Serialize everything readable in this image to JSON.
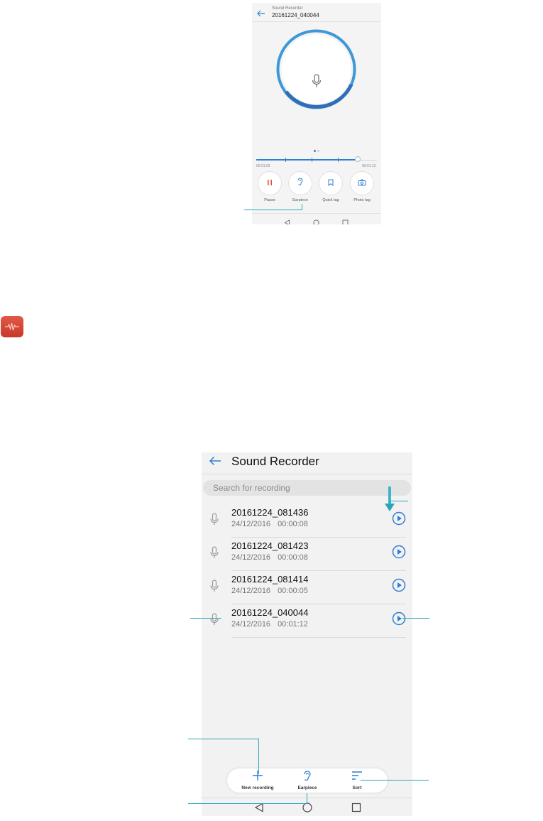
{
  "recording_screen": {
    "app_title": "Sound Recorder",
    "file_name": "20161224_040044",
    "elapsed_time": "00:01:03",
    "total_time": "00:01:12",
    "progress_fraction": 0.84,
    "page_dots": 2,
    "active_page": 0,
    "controls": [
      {
        "label": "Pause",
        "icon": "pause-icon"
      },
      {
        "label": "Earpiece",
        "icon": "ear-icon"
      },
      {
        "label": "Quick tag",
        "icon": "bookmark-icon"
      },
      {
        "label": "Photo tag",
        "icon": "camera-icon"
      }
    ]
  },
  "list_screen": {
    "title": "Sound Recorder",
    "search_placeholder": "Search for recording",
    "recordings": [
      {
        "name": "20161224_081436",
        "date": "24/12/2016",
        "duration": "00:00:08"
      },
      {
        "name": "20161224_081423",
        "date": "24/12/2016",
        "duration": "00:00:08"
      },
      {
        "name": "20161224_081414",
        "date": "24/12/2016",
        "duration": "00:00:05"
      },
      {
        "name": "20161224_040044",
        "date": "24/12/2016",
        "duration": "00:01:12"
      }
    ],
    "bottom_actions": [
      {
        "label": "New recording",
        "icon": "plus-icon"
      },
      {
        "label": "Earpiece",
        "icon": "ear-icon"
      },
      {
        "label": "Sort",
        "icon": "sort-icon"
      }
    ]
  },
  "app_icon": "sound-recorder-app-icon",
  "colors": {
    "accent": "#2f7fcf",
    "pause_red": "#e0533f",
    "callout": "#2aa3bb",
    "app_icon_red": "#d4402f"
  }
}
